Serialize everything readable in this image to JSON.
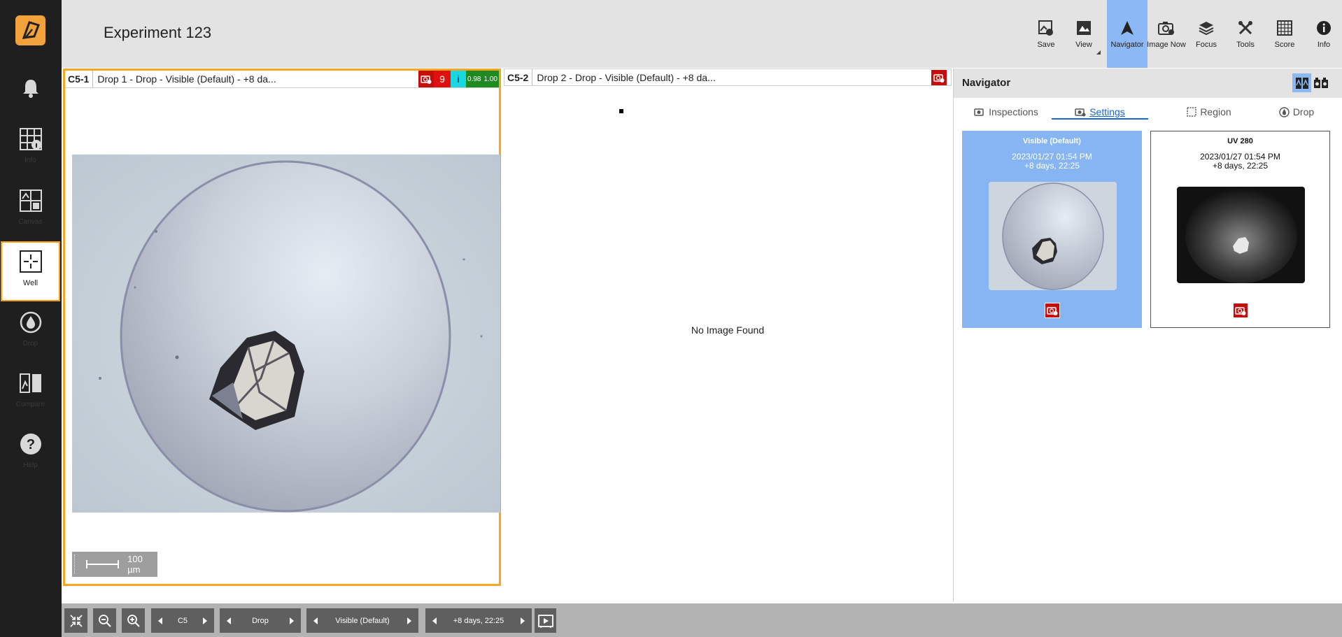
{
  "app": {
    "title": "Experiment 123"
  },
  "sidebar": {
    "items": [
      {
        "id": "notifications",
        "label": "",
        "icon": "bell-icon"
      },
      {
        "id": "info",
        "label": "Info",
        "icon": "grid-info-icon"
      },
      {
        "id": "canvas",
        "label": "Canvas",
        "icon": "canvas-icon"
      },
      {
        "id": "well",
        "label": "Well",
        "icon": "well-crosshair-icon",
        "active": true
      },
      {
        "id": "drop",
        "label": "Drop",
        "icon": "drop-icon"
      },
      {
        "id": "compare",
        "label": "Compare",
        "icon": "compare-icon"
      },
      {
        "id": "help",
        "label": "Help",
        "icon": "help-icon"
      }
    ]
  },
  "toolbar": {
    "save": "Save",
    "view": "View",
    "navigator": "Navigator",
    "image_now": "Image Now",
    "focus": "Focus",
    "tools": "Tools",
    "score": "Score",
    "info": "Info"
  },
  "left_panel": {
    "well_id": "C5-1",
    "description": "Drop 1 - Drop - Visible (Default) - +8 da...",
    "score_badge": "9",
    "info_badge": "i",
    "metric_a": "0.98",
    "metric_b": "1.00",
    "scale_label": "100 µm"
  },
  "mid_panel": {
    "well_id": "C5-2",
    "description": "Drop 2 - Drop - Visible (Default) - +8 da...",
    "message": "No Image Found"
  },
  "navigator": {
    "title": "Navigator",
    "tabs": [
      {
        "label": "Inspections",
        "active": false
      },
      {
        "label": "Settings",
        "active": true
      },
      {
        "label": "Region",
        "active": false
      },
      {
        "label": "Drop",
        "active": false
      }
    ],
    "cards": [
      {
        "name": "Visible (Default)",
        "date": "2023/01/27 01:54 PM",
        "offset": "+8 days, 22:25",
        "selected": true
      },
      {
        "name": "UV 280",
        "date": "2023/01/27 01:54 PM",
        "offset": "+8 days, 22:25",
        "selected": false
      }
    ]
  },
  "bottom": {
    "well": "C5",
    "drop": "Drop",
    "imaging": "Visible (Default)",
    "time": "+8 days, 22:25"
  },
  "colors": {
    "accent_orange": "#f5a623",
    "active_blue": "#8db8f6",
    "sidebar_bg": "#1f1f1f",
    "alert_red": "#c40d0d"
  }
}
